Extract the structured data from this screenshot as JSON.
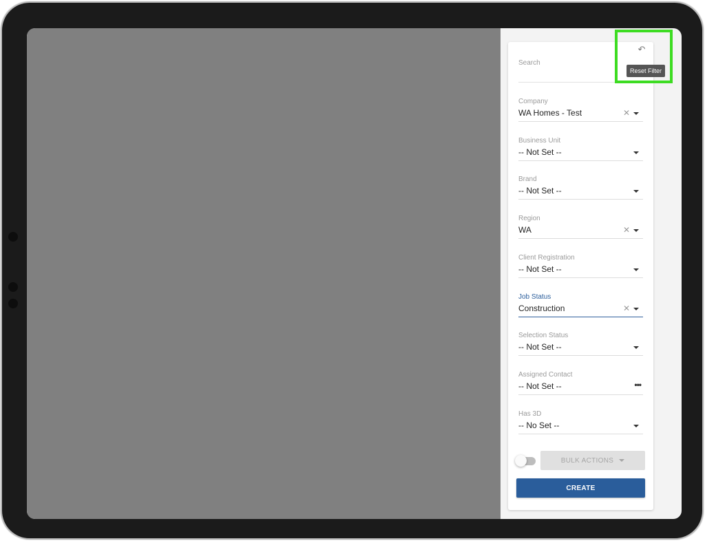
{
  "panel": {
    "reset_icon": "undo-icon",
    "reset_tooltip": "Reset Filter",
    "search": {
      "label": "Search",
      "value": ""
    },
    "fields": [
      {
        "label": "Company",
        "value": "WA Homes - Test",
        "clearable": true,
        "control": "dropdown"
      },
      {
        "label": "Business Unit",
        "value": "-- Not Set --",
        "clearable": false,
        "control": "dropdown"
      },
      {
        "label": "Brand",
        "value": "-- Not Set --",
        "clearable": false,
        "control": "dropdown"
      },
      {
        "label": "Region",
        "value": "WA",
        "clearable": true,
        "control": "dropdown"
      },
      {
        "label": "Client Registration",
        "value": "-- Not Set --",
        "clearable": false,
        "control": "dropdown"
      },
      {
        "label": "Job Status",
        "value": "Construction",
        "clearable": true,
        "control": "dropdown",
        "focused": true
      },
      {
        "label": "Selection Status",
        "value": "-- Not Set --",
        "clearable": false,
        "control": "dropdown"
      },
      {
        "label": "Assigned Contact",
        "value": "-- Not Set --",
        "clearable": false,
        "control": "more"
      },
      {
        "label": "Has 3D",
        "value": "-- No Set --",
        "clearable": false,
        "control": "dropdown"
      }
    ],
    "toggle_on": false,
    "bulk_actions_label": "BULK ACTIONS",
    "create_label": "CREATE"
  },
  "colors": {
    "accent": "#2a5d9b",
    "overlay": "#808080",
    "highlight": "#3ddc22"
  }
}
